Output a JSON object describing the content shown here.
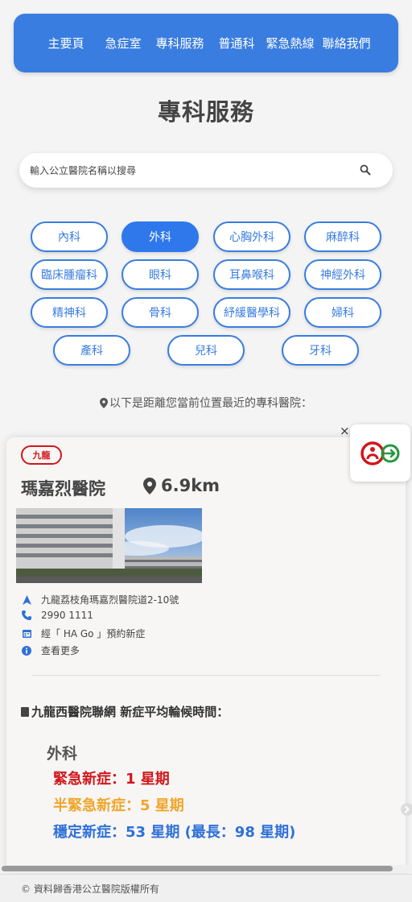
{
  "nav": {
    "links": [
      "主要頁",
      "急症室",
      "專科服務",
      "普通科",
      "緊急熱線",
      "聯絡我們"
    ]
  },
  "page_title": "專科服務",
  "search": {
    "placeholder": "輸入公立醫院名稱以搜尋",
    "value": ""
  },
  "specialties": [
    {
      "label": "內科",
      "active": false
    },
    {
      "label": "外科",
      "active": true
    },
    {
      "label": "心胸外科",
      "active": false
    },
    {
      "label": "麻醉科",
      "active": false
    },
    {
      "label": "臨床腫瘤科",
      "active": false
    },
    {
      "label": "眼科",
      "active": false
    },
    {
      "label": "耳鼻喉科",
      "active": false
    },
    {
      "label": "神經外科",
      "active": false
    },
    {
      "label": "精神科",
      "active": false
    },
    {
      "label": "骨科",
      "active": false
    },
    {
      "label": "紓緩醫學科",
      "active": false
    },
    {
      "label": "婦科",
      "active": false
    },
    {
      "label": "產科",
      "active": false
    },
    {
      "label": "兒科",
      "active": false
    },
    {
      "label": "牙科",
      "active": false
    }
  ],
  "nearest_text": "以下是距離您當前位置最近的專科醫院：",
  "hospital": {
    "region": "九龍",
    "name": "瑪嘉烈醫院",
    "distance": "6.9km",
    "address": "九龍荔枝角瑪嘉烈醫院道2-10號",
    "phone": "2990 1111",
    "booking": "經「 HA Go 」預約新症",
    "more": "查看更多"
  },
  "waiting": {
    "network": "九龍西醫院聯網 新症平均輪候時間：",
    "specialty": "外科",
    "urgent": "緊急新症：1 星期",
    "semi_urgent": "半緊急新症：5 星期",
    "stable": "穩定新症：53 星期 (最長：98 星期)"
  },
  "widget": {
    "close": "×"
  },
  "footer": "© 資料歸香港公立醫院版權所有",
  "colors": {
    "primary": "#3a7de0",
    "urgent": "#d0171b",
    "semi_urgent": "#f0a52a",
    "stable": "#2f70d8"
  }
}
